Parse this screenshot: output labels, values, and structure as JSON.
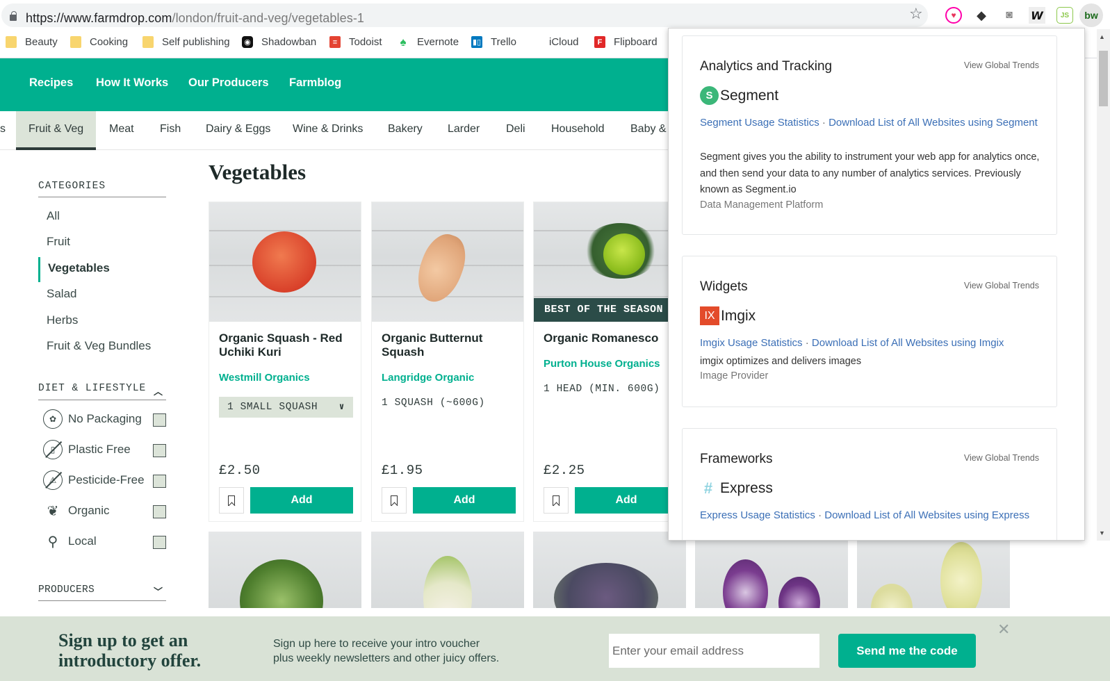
{
  "browser": {
    "url_host": "https://www.farmdrop.com",
    "url_path": "/london/fruit-and-veg/vegetables-1",
    "extensions": [
      "heart-icon",
      "eraser-icon",
      "camera-icon",
      "w-icon",
      "nodejs-icon",
      "builtwith-icon"
    ],
    "ext_labels": {
      "w": "W",
      "js": "JS",
      "bw": "bw"
    },
    "bookmarks": [
      {
        "label": "Beauty",
        "icon": "folder-icon"
      },
      {
        "label": "Cooking",
        "icon": "folder-icon"
      },
      {
        "label": "Self publishing",
        "icon": "folder-icon"
      },
      {
        "label": "Shadowban",
        "icon": "instagram-icon"
      },
      {
        "label": "Todoist",
        "icon": "todoist-icon"
      },
      {
        "label": "Evernote",
        "icon": "evernote-icon"
      },
      {
        "label": "Trello",
        "icon": "trello-icon"
      },
      {
        "label": "iCloud",
        "icon": "apple-icon"
      },
      {
        "label": "Flipboard",
        "icon": "flipboard-icon"
      }
    ]
  },
  "topnav": [
    "Recipes",
    "How It Works",
    "Our Producers",
    "Farmblog"
  ],
  "catnav": {
    "partial_left": "s",
    "tabs": [
      "Fruit & Veg",
      "Meat",
      "Fish",
      "Dairy & Eggs",
      "Wine & Drinks",
      "Bakery",
      "Larder",
      "Deli",
      "Household",
      "Baby &"
    ],
    "active": "Fruit & Veg"
  },
  "sidebar": {
    "categories_heading": "CATEGORIES",
    "categories": [
      "All",
      "Fruit",
      "Vegetables",
      "Salad",
      "Herbs",
      "Fruit & Veg Bundles"
    ],
    "active_category": "Vegetables",
    "diet_heading": "DIET & LIFESTYLE",
    "diet": [
      {
        "label": "No Packaging",
        "icon": "apple-no-packaging-icon",
        "checked": false
      },
      {
        "label": "Plastic Free",
        "icon": "plastic-free-icon",
        "checked": false
      },
      {
        "label": "Pesticide-Free",
        "icon": "pesticide-free-icon",
        "checked": false
      },
      {
        "label": "Organic",
        "icon": "leaf-icon",
        "checked": false
      },
      {
        "label": "Local",
        "icon": "location-pin-icon",
        "checked": false
      }
    ],
    "producers_heading": "PRODUCERS"
  },
  "main": {
    "title": "Vegetables",
    "products": [
      {
        "name": "Organic Squash - Red Uchiki Kuri",
        "producer": "Westmill Organics",
        "variant": "1 SMALL SQUASH",
        "variant_is_select": true,
        "price": "£2.50",
        "badge": "",
        "add_label": "Add"
      },
      {
        "name": "Organic Butternut Squash",
        "producer": "Langridge Organic",
        "variant": "1 SQUASH (~600G)",
        "variant_is_select": false,
        "price": "£1.95",
        "badge": "",
        "add_label": "Add"
      },
      {
        "name": "Organic Romanesco",
        "producer": "Purton House Organics",
        "variant": "1 HEAD (MIN. 600G)",
        "variant_is_select": false,
        "price": "£2.25",
        "badge": "BEST OF THE SEASON",
        "add_label": "Add"
      }
    ]
  },
  "popup": {
    "sections": [
      {
        "title": "Analytics and Tracking",
        "trends": "View Global Trends",
        "tech": "Segment",
        "icon": "segment-icon",
        "link_usage": "Segment Usage Statistics",
        "separator": "·",
        "link_download": "Download List of All Websites using Segment",
        "description": "Segment gives you the ability to instrument your web app for analytics once, and then send your data to any number of analytics services. Previously known as Segment.io",
        "category": "Data Management Platform"
      },
      {
        "title": "Widgets",
        "trends": "View Global Trends",
        "tech": "Imgix",
        "icon": "imgix-icon",
        "icon_text": "IX",
        "link_usage": "Imgix Usage Statistics",
        "separator": "·",
        "link_download": "Download List of All Websites using Imgix",
        "description": "imgix optimizes and delivers images",
        "category": "Image Provider"
      },
      {
        "title": "Frameworks",
        "trends": "View Global Trends",
        "tech": "Express",
        "icon": "express-icon",
        "link_usage": "Express Usage Statistics",
        "separator": "·",
        "link_download": "Download List of All Websites using Express"
      }
    ]
  },
  "signup": {
    "heading": "Sign up to get an introductory offer.",
    "text_line1": "Sign up here to receive your intro voucher",
    "text_line2": "plus weekly newsletters and other juicy offers.",
    "email_placeholder": "Enter your email address",
    "button": "Send me the code"
  },
  "colors": {
    "brand": "#00b08f",
    "dark": "#2b4c48",
    "panel": "#dce4d9",
    "link": "#3b6fb6"
  }
}
